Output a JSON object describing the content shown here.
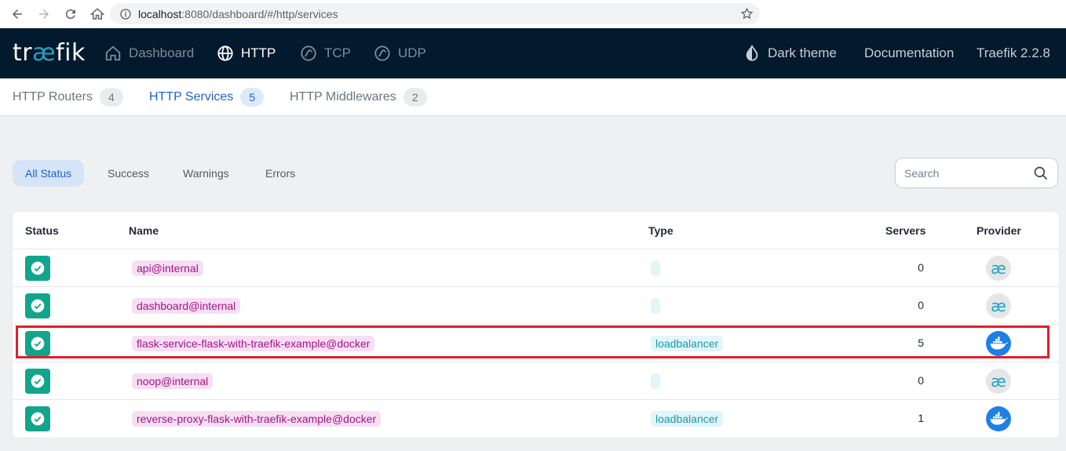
{
  "browser": {
    "url_host": "localhost",
    "url_path": ":8080/dashboard/#/http/services"
  },
  "header": {
    "logo_pre": "tr",
    "logo_ae": "æ",
    "logo_post": "fik",
    "nav": {
      "dashboard": "Dashboard",
      "http": "HTTP",
      "tcp": "TCP",
      "udp": "UDP"
    },
    "dark_theme": "Dark theme",
    "documentation": "Documentation",
    "version": "Traefik 2.2.8"
  },
  "subtabs": [
    {
      "label": "HTTP Routers",
      "count": "4"
    },
    {
      "label": "HTTP Services",
      "count": "5"
    },
    {
      "label": "HTTP Middlewares",
      "count": "2"
    }
  ],
  "filters": [
    "All Status",
    "Success",
    "Warnings",
    "Errors"
  ],
  "search": {
    "placeholder": "Search"
  },
  "table": {
    "headers": {
      "status": "Status",
      "name": "Name",
      "type": "Type",
      "servers": "Servers",
      "provider": "Provider"
    },
    "rows": [
      {
        "name": "api@internal",
        "type": "",
        "servers": "0",
        "provider": "internal"
      },
      {
        "name": "dashboard@internal",
        "type": "",
        "servers": "0",
        "provider": "internal"
      },
      {
        "name": "flask-service-flask-with-traefik-example@docker",
        "type": "loadbalancer",
        "servers": "5",
        "provider": "docker"
      },
      {
        "name": "noop@internal",
        "type": "",
        "servers": "0",
        "provider": "internal"
      },
      {
        "name": "reverse-proxy-flask-with-traefik-example@docker",
        "type": "loadbalancer",
        "servers": "1",
        "provider": "docker"
      }
    ]
  },
  "icons": {
    "internal_provider_glyph": "æ"
  },
  "colors": {
    "header_bg": "#03192d",
    "accent": "#1f63c7",
    "success": "#12a58c",
    "name_chip": "#f7dff3",
    "type_chip": "#e2f5f8",
    "highlight": "#e11e2a"
  }
}
